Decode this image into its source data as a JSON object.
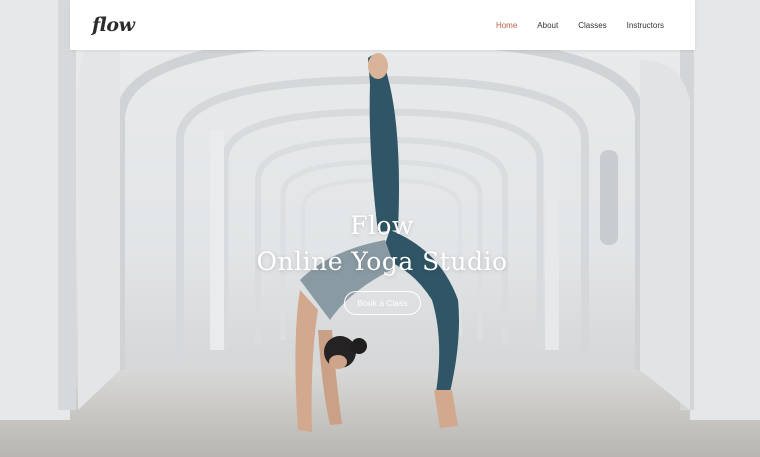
{
  "nav": {
    "logo": "flow",
    "items": [
      {
        "label": "Home",
        "active": true
      },
      {
        "label": "About",
        "active": false
      },
      {
        "label": "Classes",
        "active": false
      },
      {
        "label": "Instructors",
        "active": false
      }
    ]
  },
  "hero": {
    "title": "Flow",
    "subtitle": "Online Yoga Studio",
    "cta_label": "Book a Class"
  },
  "colors": {
    "accent": "#b95c45",
    "nav_bg": "#ffffff",
    "hero_text": "#ffffff"
  }
}
